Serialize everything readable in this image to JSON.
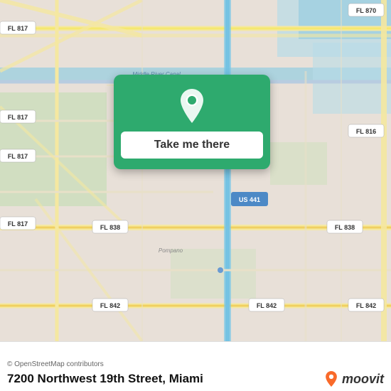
{
  "map": {
    "attribution": "© OpenStreetMap contributors",
    "background_color": "#e8e0d8"
  },
  "popup": {
    "button_label": "Take me there",
    "pin_icon": "location-pin"
  },
  "bottom_bar": {
    "address": "7200 Northwest 19th Street, Miami",
    "attribution": "© OpenStreetMap contributors",
    "logo_text": "moovit"
  },
  "road_labels": [
    "FL 817",
    "FL 817",
    "FL 817",
    "FL 817",
    "FL 870",
    "FL 816",
    "FL 838",
    "FL 838",
    "FL 842",
    "FL 842",
    "FL 842",
    "US 441",
    "US 441",
    "Middle River Canal"
  ]
}
